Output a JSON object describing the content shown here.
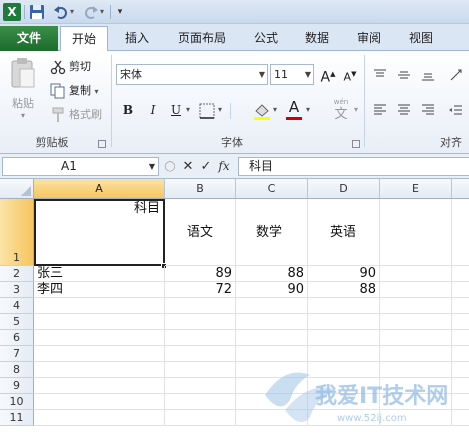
{
  "quick_access": {
    "logo": "X"
  },
  "tabs": [
    {
      "label": "文件"
    },
    {
      "label": "开始"
    },
    {
      "label": "插入"
    },
    {
      "label": "页面布局"
    },
    {
      "label": "公式"
    },
    {
      "label": "数据"
    },
    {
      "label": "审阅"
    },
    {
      "label": "视图"
    }
  ],
  "ribbon": {
    "clipboard": {
      "paste_label": "粘贴",
      "cut_label": "剪切",
      "copy_label": "复制",
      "format_painter_label": "格式刷",
      "group_label": "剪贴板"
    },
    "font": {
      "font_name": "宋体",
      "font_size": "11",
      "grow_label": "A",
      "shrink_label": "A",
      "bold": "B",
      "italic": "I",
      "underline": "U",
      "font_color_letter": "A",
      "phonetic": "wén",
      "group_label": "字体"
    },
    "alignment": {
      "group_label": "对齐"
    }
  },
  "formula_bar": {
    "name_box": "A1",
    "fx_label": "fx",
    "content": "科目"
  },
  "columns": [
    {
      "label": "A",
      "selected": true
    },
    {
      "label": "B"
    },
    {
      "label": "C"
    },
    {
      "label": "D"
    },
    {
      "label": "E"
    }
  ],
  "rows": [
    {
      "num": "1",
      "cells": [
        "科目",
        "语文",
        "数学",
        "英语",
        ""
      ]
    },
    {
      "num": "2",
      "cells": [
        "张三",
        "89",
        "88",
        "90",
        ""
      ]
    },
    {
      "num": "3",
      "cells": [
        "李四",
        "72",
        "90",
        "88",
        ""
      ]
    },
    {
      "num": "4",
      "cells": [
        "",
        "",
        "",
        "",
        ""
      ]
    },
    {
      "num": "5",
      "cells": [
        "",
        "",
        "",
        "",
        ""
      ]
    },
    {
      "num": "6",
      "cells": [
        "",
        "",
        "",
        "",
        ""
      ]
    },
    {
      "num": "7",
      "cells": [
        "",
        "",
        "",
        "",
        ""
      ]
    },
    {
      "num": "8",
      "cells": [
        "",
        "",
        "",
        "",
        ""
      ]
    },
    {
      "num": "9",
      "cells": [
        "",
        "",
        "",
        "",
        ""
      ]
    },
    {
      "num": "10",
      "cells": [
        "",
        "",
        "",
        "",
        ""
      ]
    },
    {
      "num": "11",
      "cells": [
        "",
        "",
        "",
        "",
        ""
      ]
    }
  ],
  "watermark": {
    "text": "我爱IT技术网",
    "url": "www.52ij.com"
  },
  "colors": {
    "file_tab": "#1d6b2e",
    "selection_header": "#f6c55e",
    "ribbon_bg": "#e8eef7",
    "font_color_bar": "#d00000",
    "highlight_bar": "#ffff00"
  }
}
